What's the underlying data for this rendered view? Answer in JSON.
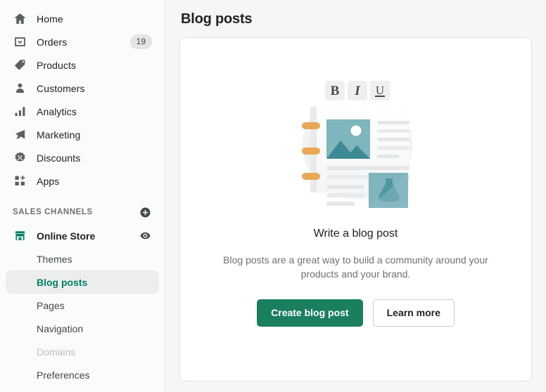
{
  "colors": {
    "brand_green": "#1a7f5f",
    "selected_text": "#007f5f",
    "page_bg": "#f6f6f7",
    "sidebar_bg": "#fafbfb",
    "badge_bg": "#e4e5e7",
    "illustration_teal_light": "#7fb5bd",
    "illustration_teal_dark": "#3e8a94",
    "illustration_orange": "#e8a855"
  },
  "sidebar": {
    "nav_items": [
      {
        "label": "Home",
        "icon": "home-icon",
        "badge": null
      },
      {
        "label": "Orders",
        "icon": "orders-icon",
        "badge": "19"
      },
      {
        "label": "Products",
        "icon": "products-icon",
        "badge": null
      },
      {
        "label": "Customers",
        "icon": "customers-icon",
        "badge": null
      },
      {
        "label": "Analytics",
        "icon": "analytics-icon",
        "badge": null
      },
      {
        "label": "Marketing",
        "icon": "marketing-icon",
        "badge": null
      },
      {
        "label": "Discounts",
        "icon": "discounts-icon",
        "badge": null
      },
      {
        "label": "Apps",
        "icon": "apps-icon",
        "badge": null
      }
    ],
    "section": {
      "title": "SALES CHANNELS",
      "add_icon": "plus-circle-icon"
    },
    "channel": {
      "label": "Online Store",
      "icon": "storefront-icon",
      "preview_icon": "eye-icon"
    },
    "sub_items": [
      {
        "label": "Themes",
        "state": "default"
      },
      {
        "label": "Blog posts",
        "state": "selected"
      },
      {
        "label": "Pages",
        "state": "default"
      },
      {
        "label": "Navigation",
        "state": "default"
      },
      {
        "label": "Domains",
        "state": "disabled"
      },
      {
        "label": "Preferences",
        "state": "default"
      }
    ]
  },
  "main": {
    "page_title": "Blog posts",
    "empty_state": {
      "illustration": "blog-post-editor-illustration",
      "toolbar_buttons": [
        "B",
        "I",
        "U"
      ],
      "title": "Write a blog post",
      "body": "Blog posts are a great way to build a community around your products and your brand.",
      "primary_button": "Create blog post",
      "secondary_button": "Learn more"
    }
  }
}
